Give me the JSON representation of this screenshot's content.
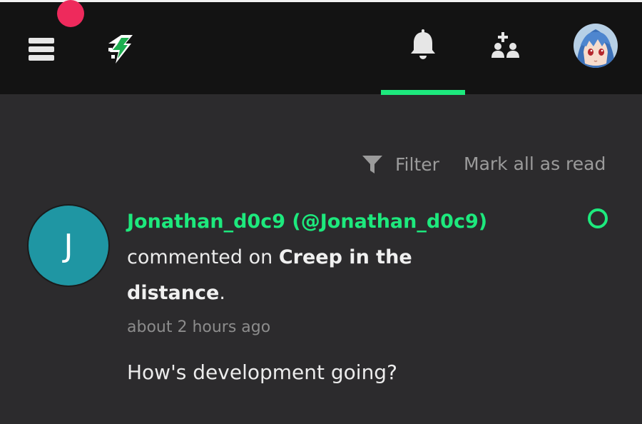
{
  "colors": {
    "accent": "#1de97d",
    "header_bg": "#131313",
    "page_bg": "#2c2b2d",
    "badge": "#ee2a5c",
    "avatar_letter_bg": "#1f96a3",
    "muted_text": "#9b9b9b",
    "icon": "#e6e6e6"
  },
  "header": {
    "menu_icon": "hamburger-menu-icon",
    "logo_icon": "lightning-bolt-logo-icon",
    "notifications_icon": "bell-icon",
    "people_icon": "add-person-group-icon",
    "profile_avatar": "user-profile-avatar-anime-blue-hair",
    "active_tab": "notifications"
  },
  "toolbar": {
    "filter_icon": "funnel-icon",
    "filter_label": "Filter",
    "mark_all_read_label": "Mark all as read"
  },
  "notification": {
    "avatar_letter": "J",
    "author": "Jonathan_d0c9 (@Jonathan_d0c9)",
    "action": "commented on ",
    "post_title_line1": "Creep in the",
    "post_title_line2": "distance",
    "suffix": ".",
    "time": "about 2 hours ago",
    "comment": "How's development going?",
    "unread_indicator_icon": "unread-circle-icon"
  }
}
